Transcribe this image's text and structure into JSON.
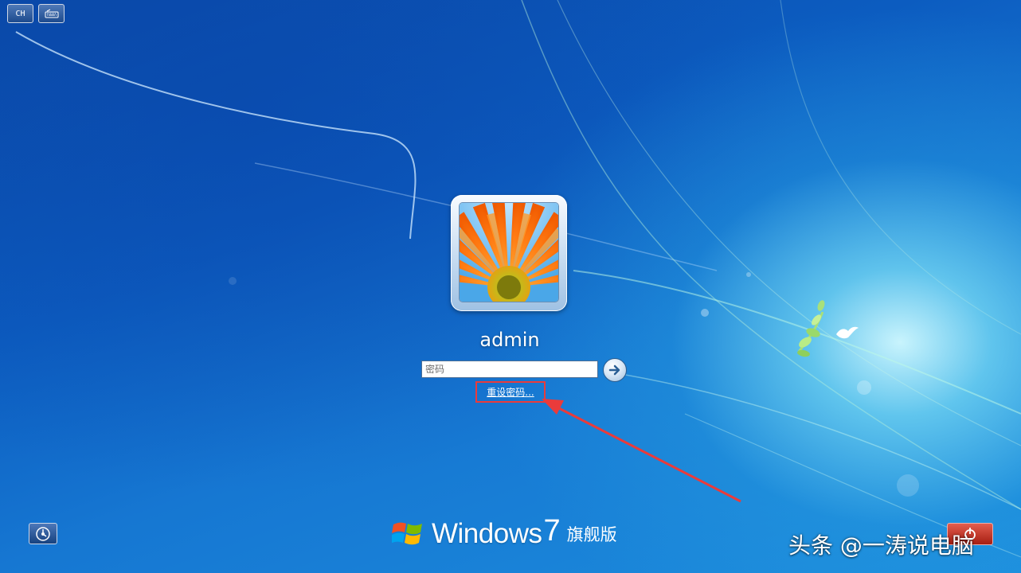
{
  "toolbar": {
    "language_label": "CH",
    "keyboard_icon": "keyboard-icon"
  },
  "user": {
    "name": "admin",
    "avatar_icon": "flower-avatar"
  },
  "login": {
    "password_placeholder": "密码",
    "password_value": "",
    "submit_icon": "arrow-right-icon",
    "reset_link_label": "重设密码..."
  },
  "branding": {
    "name": "Windows",
    "version": "7",
    "edition": "旗舰版"
  },
  "footer": {
    "ease_of_access_icon": "ease-of-access-icon",
    "shutdown_icon": "shutdown-icon",
    "watermark": "头条 @一涛说电脑"
  },
  "colors": {
    "annotation": "#ea3b3b",
    "background_dark": "#0a4aa8",
    "background_light": "#1c8ddd"
  }
}
